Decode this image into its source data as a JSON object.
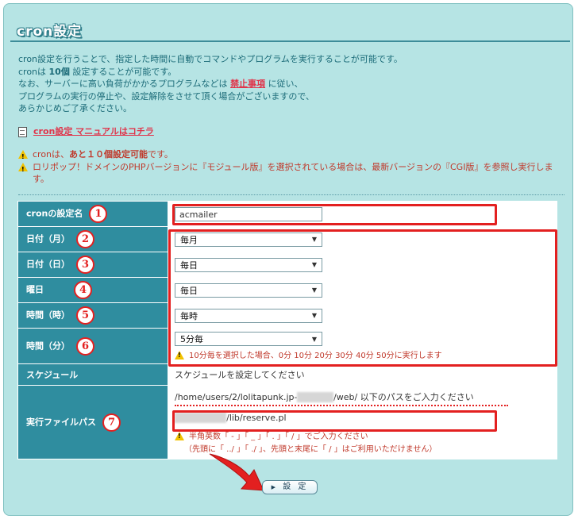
{
  "title": "cron設定",
  "intro": {
    "line1": "cron設定を行うことで、指定した時間に自動でコマンドやプログラムを実行することが可能です。",
    "line2_pre": "cronは",
    "line2_bold": "10個",
    "line2_post": "設定することが可能です。",
    "line3_pre": "なお、サーバーに高い負荷がかかるプログラムなどは",
    "line3_link": "禁止事項",
    "line3_post": "に従い、",
    "line4": "プログラムの実行の停止や、設定解除をさせて頂く場合がございますので、",
    "line5": "あらかじめご了承ください。"
  },
  "manual_link": "cron設定 マニュアルはコチラ",
  "warnings": {
    "w1_pre": "cronは、",
    "w1_bold": "あと１０個設定可能",
    "w1_post": "です。",
    "w2": "ロリポップ！ドメインのPHPバージョンに『モジュール版』を選択されている場合は、最新バージョンの『CGI版』を参照し実行します。"
  },
  "form": {
    "name": {
      "label": "cronの設定名",
      "num": "1",
      "value": "acmailer"
    },
    "month": {
      "label": "日付（月）",
      "num": "2",
      "value": "毎月"
    },
    "day": {
      "label": "日付（日）",
      "num": "3",
      "value": "毎日"
    },
    "weekday": {
      "label": "曜日",
      "num": "4",
      "value": "毎日"
    },
    "hour": {
      "label": "時間（時）",
      "num": "5",
      "value": "毎時"
    },
    "minute": {
      "label": "時間（分）",
      "num": "6",
      "value": "5分毎",
      "note": "10分毎を選択した場合、0分 10分 20分 30分 40分 50分に実行します"
    },
    "schedule": {
      "label": "スケジュール",
      "value": "スケジュールを設定してください"
    },
    "path": {
      "label": "実行ファイルパス",
      "num": "7",
      "hint_pre": "/home/users/2/lolitapunk.jp-",
      "hint_mask": "xxxxxxx",
      "hint_post": "/web/ 以下のパスをご入力ください",
      "value_mask": "xxxxxxxxxx",
      "value": "/lib/reserve.pl",
      "note1": "半角英数「 - 」「 _ 」「 . 」「 / 」でご入力ください",
      "note2": "（先頭に「 ../ 」「 ./ 」、先頭と末尾に「 / 」はご利用いただけません）"
    }
  },
  "submit_label": "設 定",
  "colors": {
    "panel": "#b6e4e4",
    "label_bg": "#2f8d9f",
    "highlight": "#e32020",
    "warn": "#c0392b"
  }
}
